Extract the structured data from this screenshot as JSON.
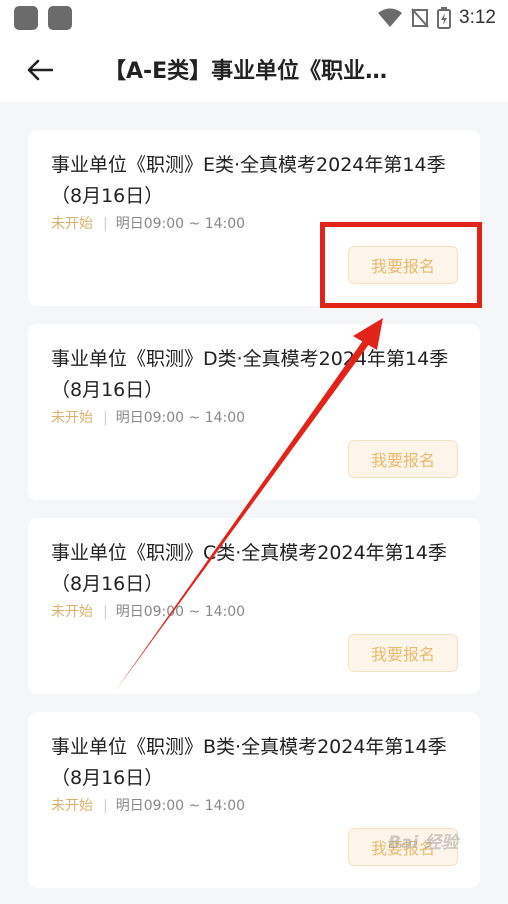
{
  "status_bar": {
    "time": "3:12"
  },
  "header": {
    "title": "【A-E类】事业单位《职业…"
  },
  "cards": [
    {
      "title": "事业单位《职测》E类·全真模考2024年第14季（8月16日）",
      "status": "未开始",
      "time": "明日09:00 ~ 14:00",
      "button": "我要报名"
    },
    {
      "title": "事业单位《职测》D类·全真模考2024年第14季（8月16日）",
      "status": "未开始",
      "time": "明日09:00 ~ 14:00",
      "button": "我要报名"
    },
    {
      "title": "事业单位《职测》C类·全真模考2024年第14季（8月16日）",
      "status": "未开始",
      "time": "明日09:00 ~ 14:00",
      "button": "我要报名"
    },
    {
      "title": "事业单位《职测》B类·全真模考2024年第14季（8月16日）",
      "status": "未开始",
      "time": "明日09:00 ~ 14:00",
      "button": "我要报名"
    }
  ],
  "icons": {
    "back": "arrow-left-icon",
    "wifi": "wifi-icon",
    "signal": "no-signal-icon",
    "battery": "battery-charging-icon"
  },
  "colors": {
    "status_text": "#d8b26a",
    "button_text": "#e7ba70",
    "button_bg": "#fdf5e9",
    "annotation": "#e2231a"
  },
  "watermark": "Bai 经验"
}
